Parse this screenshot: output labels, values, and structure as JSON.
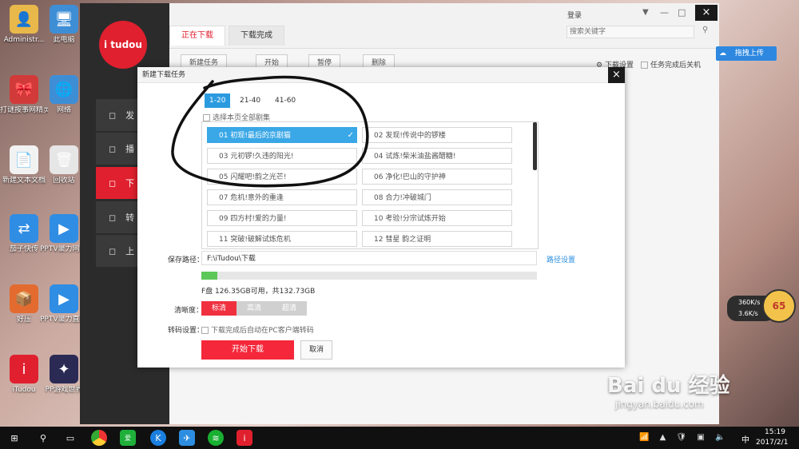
{
  "desktop": {
    "icons": [
      {
        "label": "Administr...",
        "color": "#e8b84a",
        "glyph": "👤"
      },
      {
        "label": "此电脑",
        "color": "#3e8ed6",
        "glyph": "🖥"
      },
      {
        "label": "打谜按事网精灵",
        "color": "#d23a3a",
        "glyph": "🎀"
      },
      {
        "label": "网络",
        "color": "#3e8ed6",
        "glyph": "🌐"
      },
      {
        "label": "新建文本文档",
        "color": "#f2f2f2",
        "glyph": "📄"
      },
      {
        "label": "回收站",
        "color": "#e6e6e6",
        "glyph": "🗑"
      },
      {
        "label": "茄子快传",
        "color": "#2f8de4",
        "glyph": "⇄"
      },
      {
        "label": "PPTV聚力网络电视",
        "color": "#2f8de4",
        "glyph": "▶"
      },
      {
        "label": "好压",
        "color": "#e46b2f",
        "glyph": "📦"
      },
      {
        "label": "PPTV聚力直接影院",
        "color": "#2f8de4",
        "glyph": "▶"
      },
      {
        "label": "iTudou",
        "color": "#e0202e",
        "glyph": "i"
      },
      {
        "label": "PP游戏世界",
        "color": "#2a2a55",
        "glyph": "✦"
      }
    ]
  },
  "app": {
    "logo_text": "i tudou",
    "login_label": "登录",
    "search_placeholder": "搜索关键字",
    "tabs": [
      {
        "label": "正在下载"
      },
      {
        "label": "下载完成"
      }
    ],
    "toolbar": {
      "new_task": "新建任务",
      "start": "开始",
      "pause": "暂停",
      "delete": "删除",
      "download_settings": "下载设置",
      "shutdown_after": "任务完成后关机"
    },
    "sidebar": [
      {
        "label": "发"
      },
      {
        "label": "播"
      },
      {
        "label": "下"
      },
      {
        "label": "转"
      },
      {
        "label": "上"
      }
    ],
    "upload_button": "拖拽上传"
  },
  "dialog": {
    "title": "新建下载任务",
    "close": "×",
    "range_tabs": [
      {
        "label": "1-20"
      },
      {
        "label": "21-40"
      },
      {
        "label": "41-60"
      }
    ],
    "select_all": "选择本页全部剧集",
    "episodes": [
      {
        "label": "01 初现!最后的京剧猫",
        "selected": true
      },
      {
        "label": "02 发现!传说中的锣楼",
        "selected": false
      },
      {
        "label": "03 元初锣!久违的阳光!",
        "selected": false
      },
      {
        "label": "04 试炼!柴米油盐酱醋糖!",
        "selected": false
      },
      {
        "label": "05 闪耀吧!韵之光芒!",
        "selected": false
      },
      {
        "label": "06 净化!巴山的守护神",
        "selected": false
      },
      {
        "label": "07 危机!意外的重逢",
        "selected": false
      },
      {
        "label": "08 合力!冲破城门",
        "selected": false
      },
      {
        "label": "09 四方村!爱的力量!",
        "selected": false
      },
      {
        "label": "10 考验!分宗试炼开始",
        "selected": false
      },
      {
        "label": "11 突破!破解试炼危机",
        "selected": false
      },
      {
        "label": "12 彗星 韵之证明",
        "selected": false
      }
    ],
    "save_path_label": "保存路径：",
    "save_path_value": "F:\\iTudou\\下载",
    "path_settings": "路径设置",
    "disk_info": "F盘 126.35GB可用，共132.73GB",
    "disk_used_fraction": 0.047,
    "quality_label": "清晰度：",
    "quality_options": [
      {
        "label": "标清",
        "active": true
      },
      {
        "label": "高清",
        "active": false
      },
      {
        "label": "超清",
        "active": false
      }
    ],
    "transcode_label": "转码设置：",
    "transcode_option": "下载完成后自动在PC客户端转码",
    "start_button": "开始下载",
    "cancel_button": "取消"
  },
  "speed_widget": {
    "percent": "65",
    "up": "360K/s",
    "down": "3.6K/s"
  },
  "watermark": {
    "line1": "Bai du 经验",
    "line2": "jingyan.baidu.com"
  },
  "taskbar": {
    "ime": "中",
    "time": "15:19",
    "date": "2017/2/1"
  }
}
